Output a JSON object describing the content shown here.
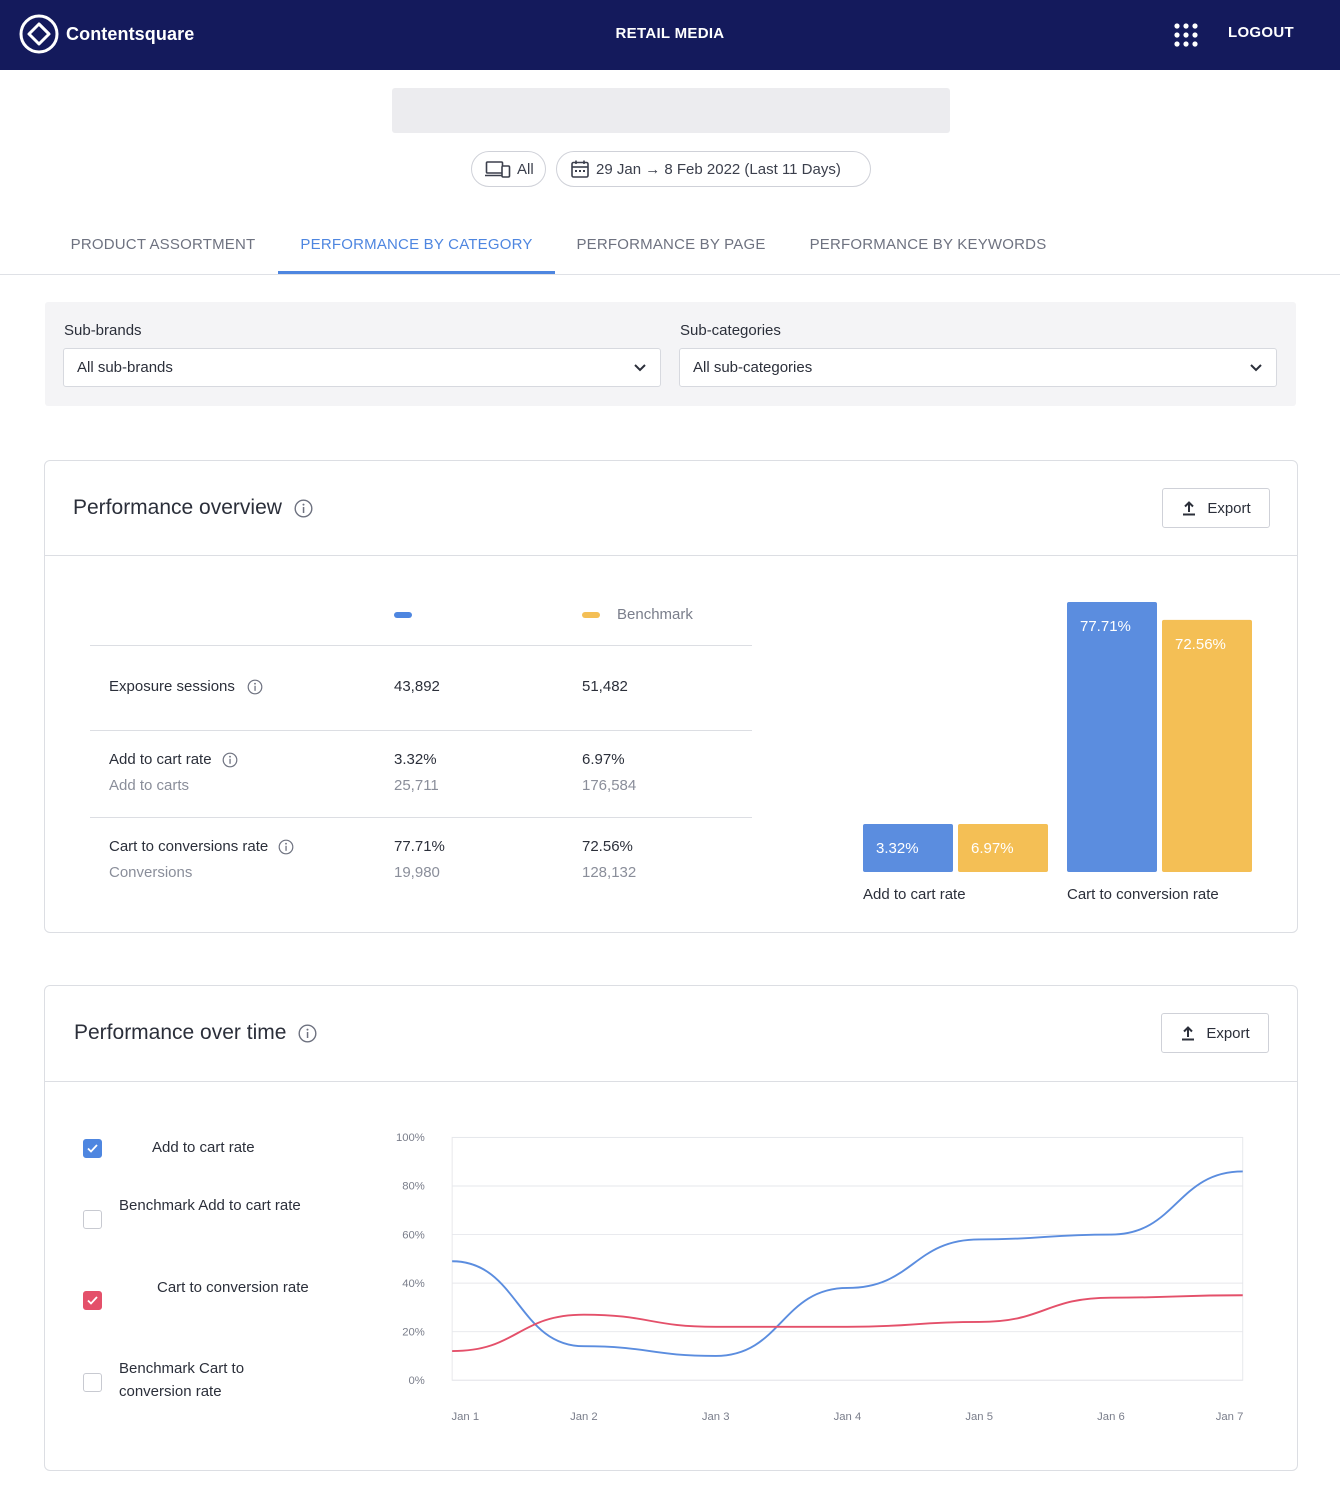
{
  "app": {
    "brand": "Contentsquare",
    "title": "RETAIL MEDIA",
    "logout_label": "LOGOUT",
    "icons": {
      "logo": "contentsquare-logo-icon",
      "apps": "apps-grid-icon"
    }
  },
  "filters_bar": {
    "device_label": "All",
    "date_range_label": "29 Jan → 8 Feb 2022 (Last 11 Days)",
    "icons": {
      "device": "devices-icon",
      "date": "calendar-icon"
    }
  },
  "tabs": [
    {
      "label": "PRODUCT ASSORTMENT",
      "active": false
    },
    {
      "label": "PERFORMANCE BY CATEGORY",
      "active": true
    },
    {
      "label": "PERFORMANCE BY PAGE",
      "active": false
    },
    {
      "label": "PERFORMANCE BY KEYWORDS",
      "active": false
    }
  ],
  "filters": {
    "subbrands_label": "Sub-brands",
    "subbrands_value": "All sub-brands",
    "subcategories_label": "Sub-categories",
    "subcategories_value": "All sub-categories"
  },
  "overview": {
    "title": "Performance overview",
    "export_label": "Export",
    "legend": {
      "primary": "",
      "benchmark": "Benchmark"
    },
    "rows": [
      {
        "label": "Exposure sessions",
        "sublabel": "",
        "value": "43,892",
        "value_sub": "",
        "bench": "51,482",
        "bench_sub": ""
      },
      {
        "label": "Add to cart rate",
        "sublabel": "Add to carts",
        "value": "3.32%",
        "value_sub": "25,711",
        "bench": "6.97%",
        "bench_sub": "176,584"
      },
      {
        "label": "Cart to conversions rate",
        "sublabel": "Conversions",
        "value": "77.71%",
        "value_sub": "19,980",
        "bench": "72.56%",
        "bench_sub": "128,132"
      }
    ]
  },
  "overview_chart": {
    "chart_data": {
      "type": "bar",
      "categories": [
        "Add to cart rate",
        "Cart to conversion rate"
      ],
      "series": [
        {
          "values": [
            3.32,
            77.71
          ],
          "color": "#5b8ddf"
        },
        {
          "name": "Benchmark",
          "values": [
            6.97,
            72.56
          ],
          "color": "#f4bf55"
        }
      ],
      "data_labels": [
        [
          "3.32%",
          "77.71%"
        ],
        [
          "6.97%",
          "72.56%"
        ]
      ]
    }
  },
  "over_time": {
    "title": "Performance over time",
    "export_label": "Export",
    "toggles": [
      {
        "label": "Add to cart rate",
        "checked": true,
        "color": "#4e86e0"
      },
      {
        "label": "Benchmark Add to cart rate",
        "checked": false,
        "color": ""
      },
      {
        "label": "Cart to conversion rate",
        "checked": true,
        "color": "#e4506a"
      },
      {
        "label": "Benchmark Cart to conversion rate",
        "checked": false,
        "color": ""
      }
    ],
    "chart_data": {
      "type": "line",
      "x": [
        "Jan 1",
        "Jan 2",
        "Jan 3",
        "Jan 4",
        "Jan 5",
        "Jan 6",
        "Jan 7"
      ],
      "y_ticks": [
        "0%",
        "20%",
        "40%",
        "60%",
        "80%",
        "100%"
      ],
      "ylim": [
        0,
        100
      ],
      "grid": true,
      "series": [
        {
          "name": "Add to cart rate",
          "color": "#5b8ddf",
          "values": [
            49,
            14,
            10,
            38,
            58,
            60,
            86
          ]
        },
        {
          "name": "Cart to conversion rate",
          "color": "#e4506a",
          "values": [
            12,
            27,
            22,
            22,
            24,
            34,
            35
          ]
        }
      ]
    }
  }
}
